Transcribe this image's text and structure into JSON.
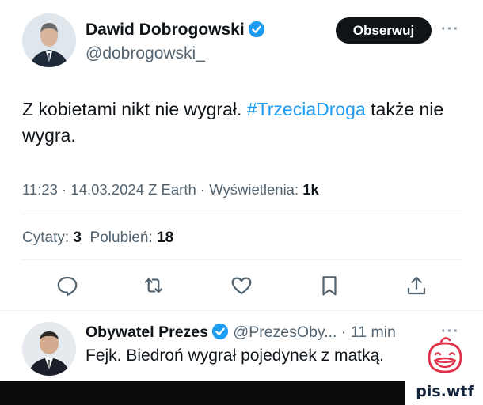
{
  "tweet": {
    "author_name": "Dawid Dobrogowski",
    "author_handle": "@dobrogowski_",
    "follow_label": "Obserwuj",
    "more_label": "···",
    "text_before": "Z kobietami nikt nie wygrał. ",
    "hashtag": "#TrzeciaDroga",
    "text_after": " także nie wygra.",
    "timestamp": "11:23 · 14.03.2024 Z Earth · Wyświetlenia:",
    "views": "1k",
    "quotes_label": "Cytaty:",
    "quotes_count": "3",
    "likes_label": "Polubień:",
    "likes_count": "18"
  },
  "actions": {
    "reply_icon": "reply-icon",
    "retweet_icon": "retweet-icon",
    "like_icon": "heart-icon",
    "bookmark_icon": "bookmark-icon",
    "share_icon": "share-icon"
  },
  "reply": {
    "author_name": "Obywatel Prezes",
    "author_handle": "@PrezesOby...",
    "time": "· 11 min",
    "more_label": "···",
    "text": "Fejk. Biedroń wygrał pojedynek z matką."
  },
  "watermark": {
    "text": "pis.wtf"
  },
  "colors": {
    "accent": "#1d9bf0",
    "text": "#0f1419",
    "muted": "#536471",
    "logo": "#e0304a"
  }
}
